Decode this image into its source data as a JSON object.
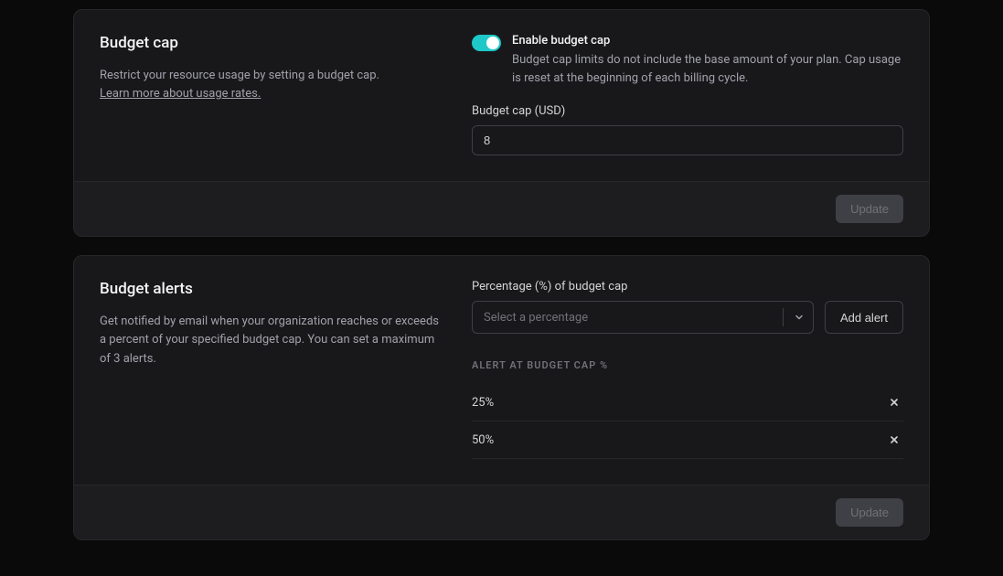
{
  "budget_cap": {
    "title": "Budget cap",
    "description": "Restrict your resource usage by setting a budget cap.",
    "learn_more": "Learn more about usage rates.",
    "toggle_label": "Enable budget cap",
    "toggle_desc": "Budget cap limits do not include the base amount of your plan. Cap usage is reset at the beginning of each billing cycle.",
    "field_label": "Budget cap (USD)",
    "value": "8",
    "update_label": "Update"
  },
  "budget_alerts": {
    "title": "Budget alerts",
    "description": "Get notified by email when your organization reaches or exceeds a percent of your specified budget cap. You can set a maximum of 3 alerts.",
    "select_label": "Percentage (%) of budget cap",
    "select_placeholder": "Select a percentage",
    "add_alert_label": "Add alert",
    "list_header": "Alert at budget cap %",
    "alerts": [
      {
        "value": "25%"
      },
      {
        "value": "50%"
      }
    ],
    "update_label": "Update"
  }
}
